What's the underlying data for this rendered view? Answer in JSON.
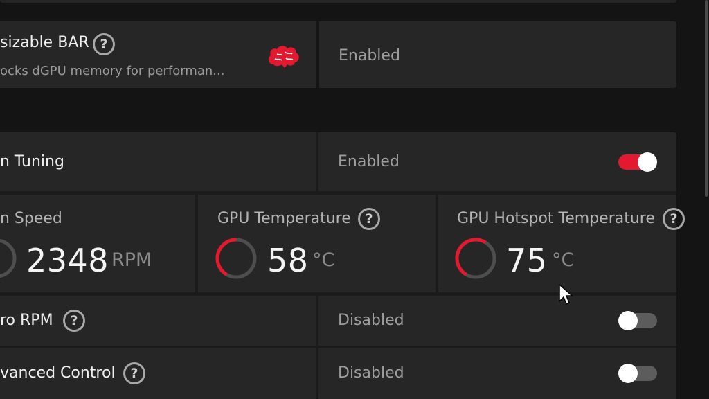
{
  "resizable_bar": {
    "title": "sizable BAR",
    "subtitle": "ocks dGPU memory for performan...",
    "value": "Enabled",
    "brain_color": "#e2192f"
  },
  "tuning": {
    "title": "n Tuning",
    "value": "Enabled",
    "enabled": true
  },
  "metrics": [
    {
      "label": "n Speed",
      "value": "2348",
      "unit": "RPM"
    },
    {
      "label": "GPU Temperature",
      "value": "58",
      "unit": "°C",
      "gauge_fraction": 0.55
    },
    {
      "label": "GPU Hotspot Temperature",
      "value": "75",
      "unit": "°C",
      "gauge_fraction": 0.66
    }
  ],
  "zero_rpm": {
    "title": "ro RPM",
    "value": "Disabled",
    "enabled": false
  },
  "advanced_control": {
    "title": "vanced Control",
    "value": "Disabled",
    "enabled": false
  },
  "help_glyph": "?",
  "colors": {
    "accent": "#e2192f",
    "panel": "#262626",
    "background": "#141414"
  }
}
